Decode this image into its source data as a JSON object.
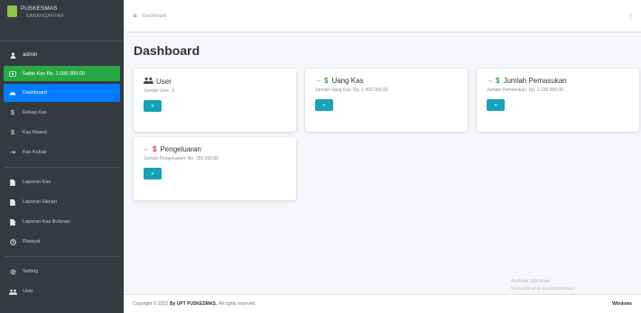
{
  "brand": {
    "title": "PUSKESMAS",
    "subtitle": "KARANGANYAR"
  },
  "sidebar": {
    "user": "admin",
    "money": "Saldo Kas Rp. 1.000.000,00",
    "group1": [
      {
        "label": "Dashboard",
        "icon": "dashboard-icon",
        "active": true
      },
      {
        "label": "Rekap Kas",
        "icon": "dollar-icon",
        "active": false
      },
      {
        "label": "Kas Masuk",
        "icon": "dollar-icon",
        "active": false
      },
      {
        "label": "Kas Keluar",
        "icon": "cash-out-icon",
        "active": false
      }
    ],
    "group2": [
      {
        "label": "Laporan Kas",
        "icon": "report-icon"
      },
      {
        "label": "Laporan Harian",
        "icon": "report-icon"
      },
      {
        "label": "Laporan Kas Bulanan",
        "icon": "report-icon"
      },
      {
        "label": "Riwayat",
        "icon": "history-icon"
      }
    ],
    "group3": [
      {
        "label": "Setting",
        "icon": "gear-icon"
      },
      {
        "label": "User",
        "icon": "users-icon"
      }
    ]
  },
  "topbar": {
    "link": "Dashboard",
    "menu_icon": "hamburger-icon"
  },
  "page": {
    "title": "Dashboard"
  },
  "cards": [
    {
      "title": "User",
      "subtitle": "Jumlah User: 3",
      "button": "»"
    },
    {
      "arrow": "→",
      "currency": "$",
      "title": "Uang Kas",
      "subtitle": "Jumlah Uang Kas: Rp. 1.000.000,00",
      "button": "»"
    },
    {
      "arrow": "→",
      "currency": "$",
      "title": "Jumlah Pemasukan",
      "subtitle": "Jumlah Pemasukan: Rp. 1.150.000,00",
      "button": "»"
    },
    {
      "arrow": "←",
      "currency": "$",
      "title": "Pengeluaran",
      "subtitle": "Jumlah Pengeluaran: Rp. 150.000,00",
      "button": "»"
    }
  ],
  "footer": {
    "text": "Copyright © 2023",
    "by": "By UPT PUSKESMAS.",
    "rights": "All rights reserved.",
    "right": "Windows"
  },
  "watermark": {
    "line1": "Activate Windows",
    "line2": "Go to Settings to activate Windows."
  },
  "colors": {
    "sidebar": "#343a40",
    "active": "#007bff",
    "money": "#28a745",
    "button": "#17a2b8"
  }
}
